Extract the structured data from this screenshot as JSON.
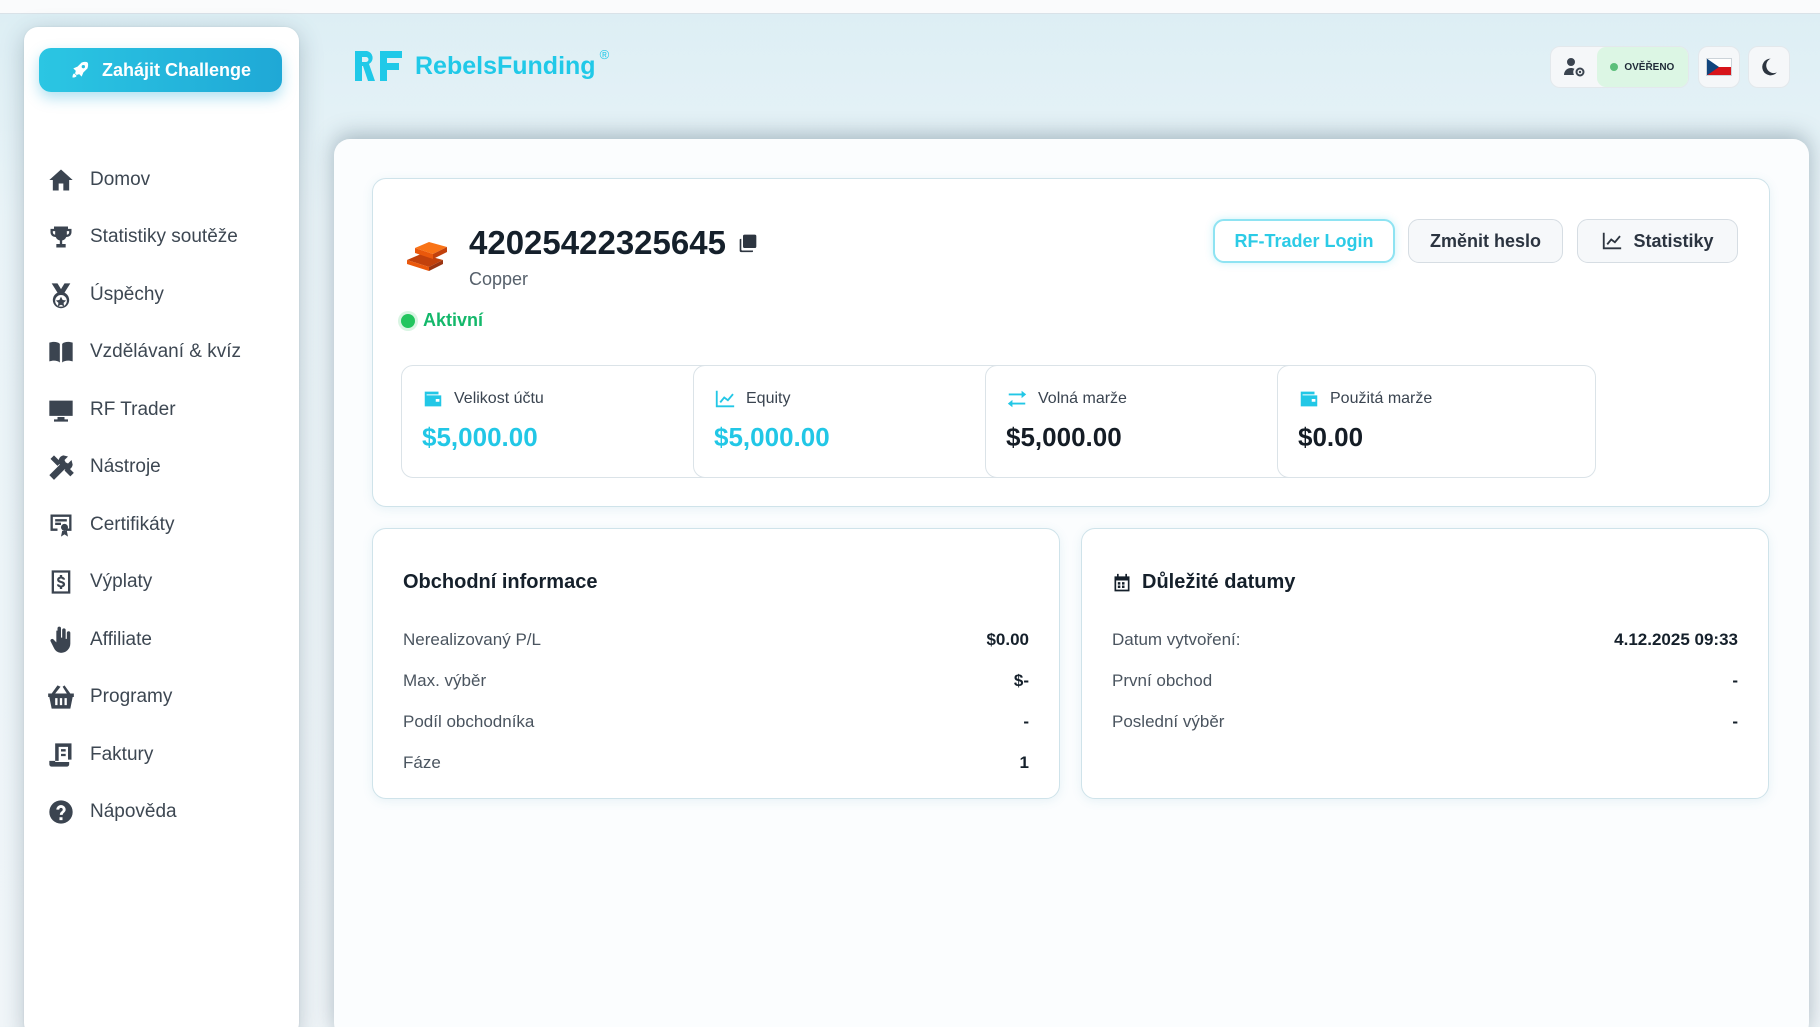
{
  "sidebar": {
    "cta_label": "Zahájit Challenge",
    "items": [
      {
        "label": "Domov",
        "icon": "home-icon"
      },
      {
        "label": "Statistiky soutěže",
        "icon": "trophy-icon"
      },
      {
        "label": "Úspěchy",
        "icon": "medal-icon"
      },
      {
        "label": "Vzdělávaní & kvíz",
        "icon": "book-icon"
      },
      {
        "label": "RF Trader",
        "icon": "monitor-icon"
      },
      {
        "label": "Nástroje",
        "icon": "tools-icon"
      },
      {
        "label": "Certifikáty",
        "icon": "certificate-icon"
      },
      {
        "label": "Výplaty",
        "icon": "payout-icon"
      },
      {
        "label": "Affiliate",
        "icon": "hand-icon"
      },
      {
        "label": "Programy",
        "icon": "basket-icon"
      },
      {
        "label": "Faktury",
        "icon": "invoice-icon"
      },
      {
        "label": "Nápověda",
        "icon": "help-icon"
      }
    ]
  },
  "header": {
    "brand": "RebelsFunding",
    "brand_mark": "®",
    "verified_label": "OVĚŘENO"
  },
  "account": {
    "number": "42025422325645",
    "tier": "Copper",
    "status": "Aktivní",
    "buttons": {
      "login": "RF-Trader Login",
      "change_password": "Změnit heslo",
      "stats": "Statistiky"
    },
    "stats": [
      {
        "label": "Velikost účtu",
        "value": "$5,000.00"
      },
      {
        "label": "Equity",
        "value": "$5,000.00"
      },
      {
        "label": "Volná marže",
        "value": "$5,000.00"
      },
      {
        "label": "Použitá marže",
        "value": "$0.00"
      }
    ]
  },
  "trading_info": {
    "title": "Obchodní informace",
    "rows": [
      {
        "k": "Nerealizovaný P/L",
        "v": "$0.00"
      },
      {
        "k": "Max. výběr",
        "v": "$-"
      },
      {
        "k": "Podíl obchodníka",
        "v": "-"
      },
      {
        "k": "Fáze",
        "v": "1"
      }
    ]
  },
  "dates": {
    "title": "Důležité datumy",
    "rows": [
      {
        "k": "Datum vytvoření:",
        "v": "4.12.2025 09:33"
      },
      {
        "k": "První obchod",
        "v": "-"
      },
      {
        "k": "Poslední výběr",
        "v": "-"
      }
    ]
  },
  "colors": {
    "accent": "#22c7e6",
    "success": "#14b86b"
  }
}
